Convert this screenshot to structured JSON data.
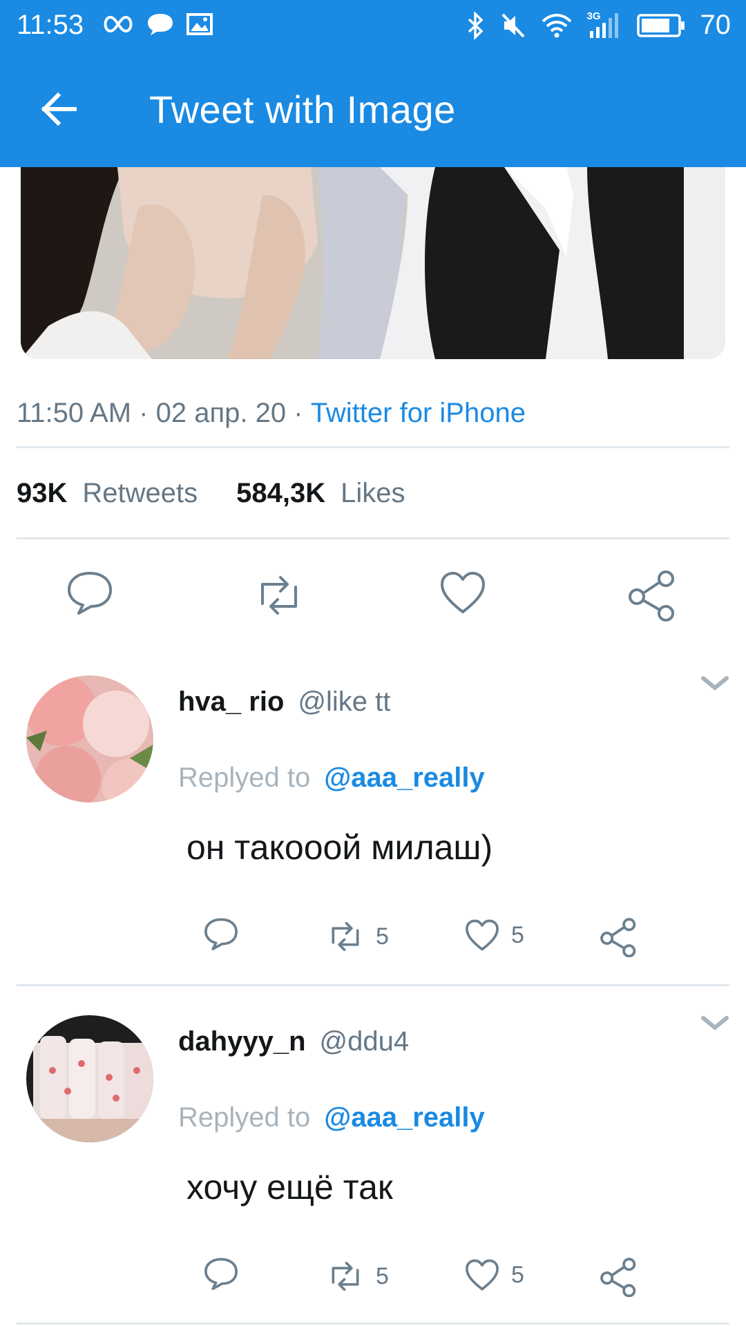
{
  "status_bar": {
    "time": "11:53",
    "network": "3G",
    "battery": "70",
    "icons": [
      "infinity-icon",
      "chat-bubble-icon",
      "image-icon",
      "bluetooth-icon",
      "mute-icon",
      "wifi-icon",
      "signal-icon",
      "battery-icon"
    ]
  },
  "app_bar": {
    "title": "Tweet with Image",
    "back_icon": "arrow-left-icon"
  },
  "colors": {
    "accent": "#1a8ae3",
    "text_primary": "#14171a",
    "text_secondary": "#657786",
    "divider": "#e1e8ed",
    "icon_gray": "#6b7f8e"
  },
  "tweet": {
    "time": "11:50 AM",
    "date": "02 апр. 20",
    "separator": "·",
    "source": "Twitter for iPhone",
    "retweets_count": "93K",
    "retweets_label": "Retweets",
    "likes_count": "584,3K",
    "likes_label": "Likes"
  },
  "replies": [
    {
      "name": "hva_ rio",
      "handle": "@like tt",
      "replied_label": "Replyed to",
      "replied_to": "@aaa_really",
      "text": "он такооой милаш)",
      "retweets": "5",
      "likes": "5"
    },
    {
      "name": "dahyyy_n",
      "handle": "@ddu4",
      "replied_label": "Replyed to",
      "replied_to": "@aaa_really",
      "text": "хочу ещё так",
      "retweets": "5",
      "likes": "5"
    }
  ]
}
